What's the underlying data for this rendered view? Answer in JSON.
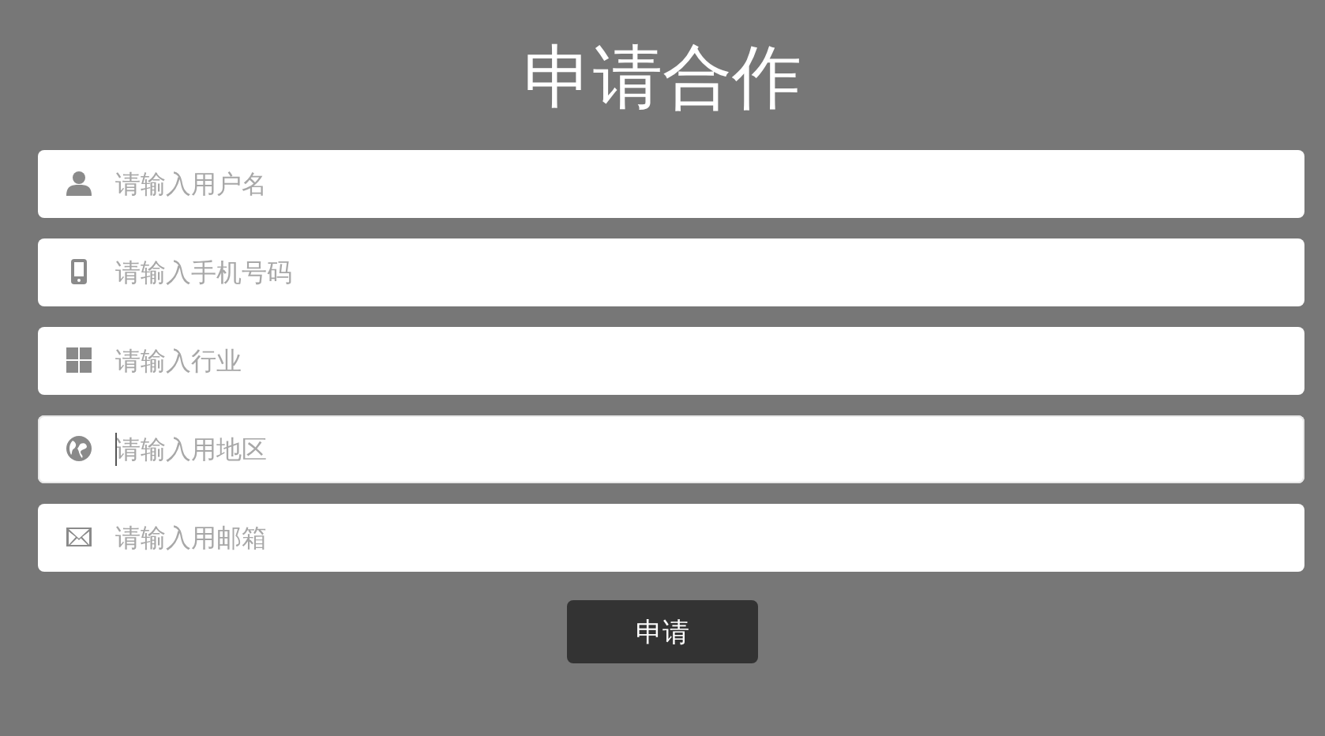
{
  "title": "申请合作",
  "fields": [
    {
      "kind": "user",
      "placeholder": "请输入用户名",
      "focused": false
    },
    {
      "kind": "phone",
      "placeholder": "请输入手机号码",
      "focused": false
    },
    {
      "kind": "grid",
      "placeholder": "请输入行业",
      "focused": false
    },
    {
      "kind": "globe",
      "placeholder": "请输入用地区",
      "focused": true
    },
    {
      "kind": "mail",
      "placeholder": "请输入用邮箱",
      "focused": false
    }
  ],
  "button": "申请"
}
